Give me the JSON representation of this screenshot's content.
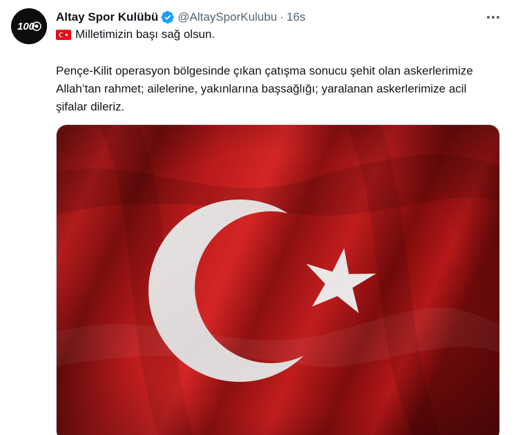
{
  "author": {
    "display_name": "Altay Spor Kulübü",
    "handle": "@AltaySporKulubu",
    "separator": "·",
    "time": "16s",
    "avatar_text": "100"
  },
  "tweet": {
    "line1": "Milletimizin başı sağ olsun.",
    "body": "Pençe-Kilit operasyon bölgesinde çıkan çatışma sonucu şehit olan askerlerimize Allah’tan rahmet; ailelerine, yakınlarına başsağlığı; yaralanan askerlerimize acil şifalar dileriz."
  },
  "icons": {
    "verified": "verified-badge-icon",
    "more": "more-icon",
    "flag": "turkey-flag-icon"
  },
  "colors": {
    "verified": "#1d9bf0",
    "flag_red": "#c8102e",
    "text": "#0f1419",
    "secondary": "#536471"
  }
}
